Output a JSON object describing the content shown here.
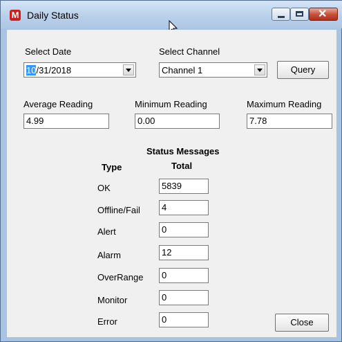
{
  "window": {
    "title": "Daily Status"
  },
  "date": {
    "label": "Select Date",
    "month_selected": "10",
    "rest": "/31/2018"
  },
  "channel": {
    "label": "Select Channel",
    "value": "Channel 1"
  },
  "query_label": "Query",
  "readings": {
    "average": {
      "label": "Average Reading",
      "value": "4.99"
    },
    "minimum": {
      "label": "Minimum Reading",
      "value": "0.00"
    },
    "maximum": {
      "label": "Maximum Reading",
      "value": "7.78"
    }
  },
  "status": {
    "heading": "Status Messages",
    "type_header": "Type",
    "total_header": "Total",
    "rows": [
      {
        "type": "OK",
        "total": "5839"
      },
      {
        "type": "Offline/Fail",
        "total": "4"
      },
      {
        "type": "Alert",
        "total": "0"
      },
      {
        "type": "Alarm",
        "total": "12"
      },
      {
        "type": "OverRange",
        "total": "0"
      },
      {
        "type": "Monitor",
        "total": "0"
      },
      {
        "type": "Error",
        "total": "0"
      }
    ]
  },
  "close_label": "Close",
  "icons": {
    "app": "app-logo-icon",
    "cursor": "mouse-cursor-icon",
    "minimize": "minimize-icon",
    "maximize": "maximize-icon",
    "close": "close-icon",
    "dropdown": "chevron-down-icon"
  },
  "colors": {
    "selection": "#3399ff",
    "close_button": "#c64d35",
    "dialog_bg": "#f0f0f0"
  }
}
